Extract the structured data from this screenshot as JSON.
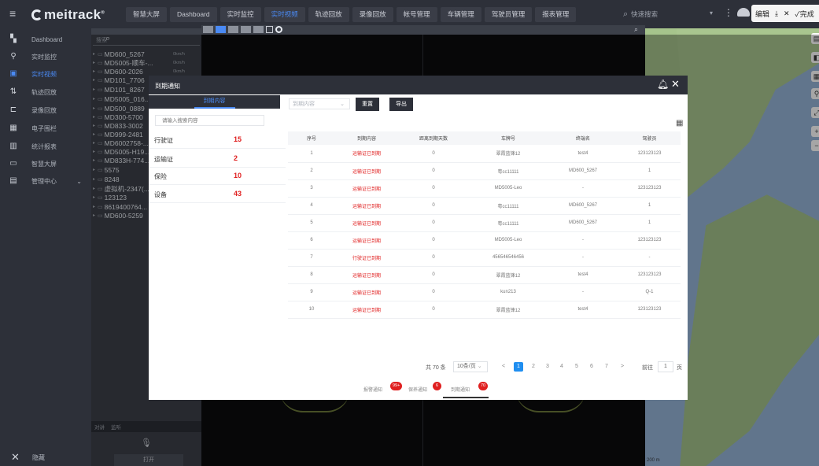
{
  "topbar": {
    "logo": "meitrack",
    "logo_mark": "®",
    "tabs": [
      "智慧大屏",
      "Dashboard",
      "实时监控",
      "实时视频",
      "轨迹回放",
      "录像回放",
      "帐号管理",
      "车辆管理",
      "驾驶员管理",
      "报表管理"
    ],
    "active_tab_index": 3,
    "search_placeholder": "快速搜索"
  },
  "edit_toolbar": {
    "edit_label": "编辑",
    "done_label": "完成"
  },
  "sidebar": {
    "items": [
      {
        "label": "Dashboard",
        "icon": "dashboard-icon"
      },
      {
        "label": "实时监控",
        "icon": "location-icon"
      },
      {
        "label": "实时视频",
        "icon": "video-icon"
      },
      {
        "label": "轨迹回放",
        "icon": "track-icon"
      },
      {
        "label": "录像回放",
        "icon": "playback-icon"
      },
      {
        "label": "电子围栏",
        "icon": "fence-icon"
      },
      {
        "label": "统计报表",
        "icon": "stats-icon"
      },
      {
        "label": "智慧大屏",
        "icon": "bigscreen-icon"
      },
      {
        "label": "管理中心",
        "icon": "management-icon"
      }
    ],
    "active_index": 2,
    "collapse_label": "隐藏"
  },
  "device_panel": {
    "search_label": "搜索",
    "devices": [
      {
        "name": "MD600_5267",
        "speed": "0km/h"
      },
      {
        "name": "MD5005-顺车-...",
        "speed": "0km/h"
      },
      {
        "name": "MD600-2026",
        "speed": "0km/h"
      },
      {
        "name": "MD101_7706",
        "speed": ""
      },
      {
        "name": "MD101_8267",
        "speed": ""
      },
      {
        "name": "MD5005_016...",
        "speed": ""
      },
      {
        "name": "MD500_0889",
        "speed": ""
      },
      {
        "name": "MD300-5700",
        "speed": ""
      },
      {
        "name": "MD833-3002",
        "speed": ""
      },
      {
        "name": "MD999-2481",
        "speed": ""
      },
      {
        "name": "MD6002758-...",
        "speed": ""
      },
      {
        "name": "MD5005-H19...",
        "speed": ""
      },
      {
        "name": "MD833H-774...",
        "speed": ""
      },
      {
        "name": "5575",
        "speed": ""
      },
      {
        "name": "8248",
        "speed": ""
      },
      {
        "name": "虚拟机-2347(...",
        "speed": ""
      },
      {
        "name": "123123",
        "speed": ""
      },
      {
        "name": "8619400764...",
        "speed": ""
      },
      {
        "name": "MD600-5259",
        "speed": ""
      }
    ],
    "bottom_tabs": [
      "对讲",
      "监听"
    ],
    "open_label": "打开"
  },
  "modal": {
    "title": "到期通知",
    "tab_label": "到期内容",
    "filter_placeholder": "到期内容",
    "reset_label": "重置",
    "export_label": "导出",
    "search_placeholder": "请输入搜索内容",
    "categories": [
      {
        "name": "行驶证",
        "count": "15"
      },
      {
        "name": "运输证",
        "count": "2"
      },
      {
        "name": "保险",
        "count": "10"
      },
      {
        "name": "设备",
        "count": "43"
      }
    ],
    "table": {
      "columns": [
        "序号",
        "到期内容",
        "距离到期天数",
        "车牌号",
        "终端名",
        "驾驶员"
      ],
      "rows": [
        [
          "1",
          "运输证已到期",
          "0",
          "翠霞蓝锋12",
          "test4",
          "123123123"
        ],
        [
          "2",
          "运输证已到期",
          "0",
          "粤cc11111",
          "MD600_5267",
          "1"
        ],
        [
          "3",
          "运输证已到期",
          "0",
          "MD5005-Leo",
          "-",
          "123123123"
        ],
        [
          "4",
          "运输证已到期",
          "0",
          "粤cc11111",
          "MD600_5267",
          "1"
        ],
        [
          "5",
          "运输证已到期",
          "0",
          "粤cc11111",
          "MD600_5267",
          "1"
        ],
        [
          "6",
          "运输证已到期",
          "0",
          "MD5005-Leo",
          "-",
          "123123123"
        ],
        [
          "7",
          "行驶证已到期",
          "0",
          "456546546456",
          "-",
          "-"
        ],
        [
          "8",
          "运输证已到期",
          "0",
          "翠霞蓝锋12",
          "test4",
          "123123123"
        ],
        [
          "9",
          "运输证已到期",
          "0",
          "kun213",
          "-",
          "Q-1"
        ],
        [
          "10",
          "运输证已到期",
          "0",
          "翠霞蓝锋12",
          "test4",
          "123123123"
        ]
      ]
    },
    "pagination": {
      "total": "共 70 条",
      "page_size": "10条/页",
      "pages": [
        "1",
        "2",
        "3",
        "4",
        "5",
        "6",
        "7"
      ],
      "prev": "<",
      "next": ">",
      "goto_label": "前往",
      "goto_value": "1",
      "goto_unit": "页"
    },
    "bottom_tabs": [
      {
        "label": "报警通知",
        "badge": "99+"
      },
      {
        "label": "保养通知",
        "badge": "6"
      },
      {
        "label": "到期通知",
        "badge": "70"
      }
    ]
  },
  "map": {
    "scale_text": "200 m"
  }
}
